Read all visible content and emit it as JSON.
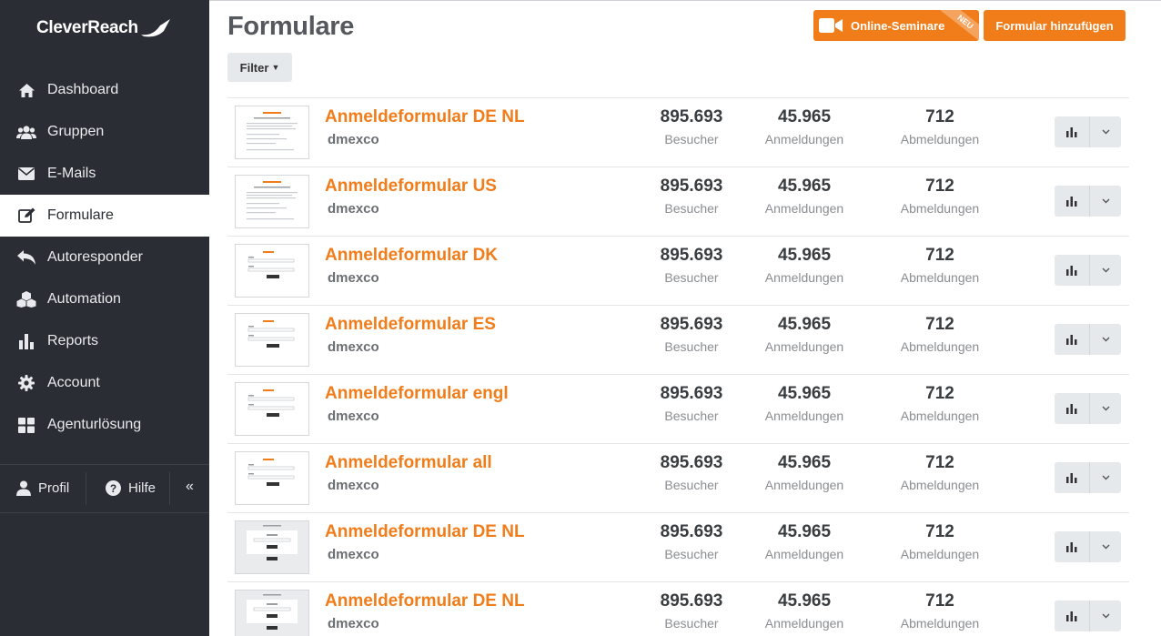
{
  "brand": {
    "name": "CleverReach",
    "accent": "#f07d1a",
    "sidebar_bg": "#2a2d33"
  },
  "sidebar": {
    "items": [
      {
        "label": "Dashboard",
        "icon": "home-icon"
      },
      {
        "label": "Gruppen",
        "icon": "users-icon"
      },
      {
        "label": "E-Mails",
        "icon": "envelope-icon"
      },
      {
        "label": "Formulare",
        "icon": "edit-icon",
        "active": true
      },
      {
        "label": "Autoresponder",
        "icon": "reply-icon"
      },
      {
        "label": "Automation",
        "icon": "cubes-icon"
      },
      {
        "label": "Reports",
        "icon": "bar-chart-icon"
      },
      {
        "label": "Account",
        "icon": "gear-icon"
      },
      {
        "label": "Agenturlösung",
        "icon": "grid-icon"
      }
    ],
    "bottom": {
      "profil": "Profil",
      "hilfe": "Hilfe",
      "collapse": "«"
    }
  },
  "header": {
    "title": "Formulare",
    "filter_label": "Filter",
    "seminare_label": "Online-Seminare",
    "seminare_badge": "NEU",
    "add_label": "Formular hinzufügen"
  },
  "stat_labels": {
    "visitors": "Besucher",
    "signups": "Anmeldungen",
    "unsubs": "Abmeldungen"
  },
  "forms": [
    {
      "name": "Anmeldeformular DE NL",
      "owner": "dmexco",
      "visitors": "895.693",
      "signups": "45.965",
      "unsubs": "712"
    },
    {
      "name": "Anmeldeformular US",
      "owner": "dmexco",
      "visitors": "895.693",
      "signups": "45.965",
      "unsubs": "712"
    },
    {
      "name": "Anmeldeformular DK",
      "owner": "dmexco",
      "visitors": "895.693",
      "signups": "45.965",
      "unsubs": "712"
    },
    {
      "name": "Anmeldeformular ES",
      "owner": "dmexco",
      "visitors": "895.693",
      "signups": "45.965",
      "unsubs": "712"
    },
    {
      "name": "Anmeldeformular engl",
      "owner": "dmexco",
      "visitors": "895.693",
      "signups": "45.965",
      "unsubs": "712"
    },
    {
      "name": "Anmeldeformular all",
      "owner": "dmexco",
      "visitors": "895.693",
      "signups": "45.965",
      "unsubs": "712"
    },
    {
      "name": "Anmeldeformular DE NL",
      "owner": "dmexco",
      "visitors": "895.693",
      "signups": "45.965",
      "unsubs": "712"
    },
    {
      "name": "Anmeldeformular DE NL",
      "owner": "dmexco",
      "visitors": "895.693",
      "signups": "45.965",
      "unsubs": "712"
    }
  ]
}
